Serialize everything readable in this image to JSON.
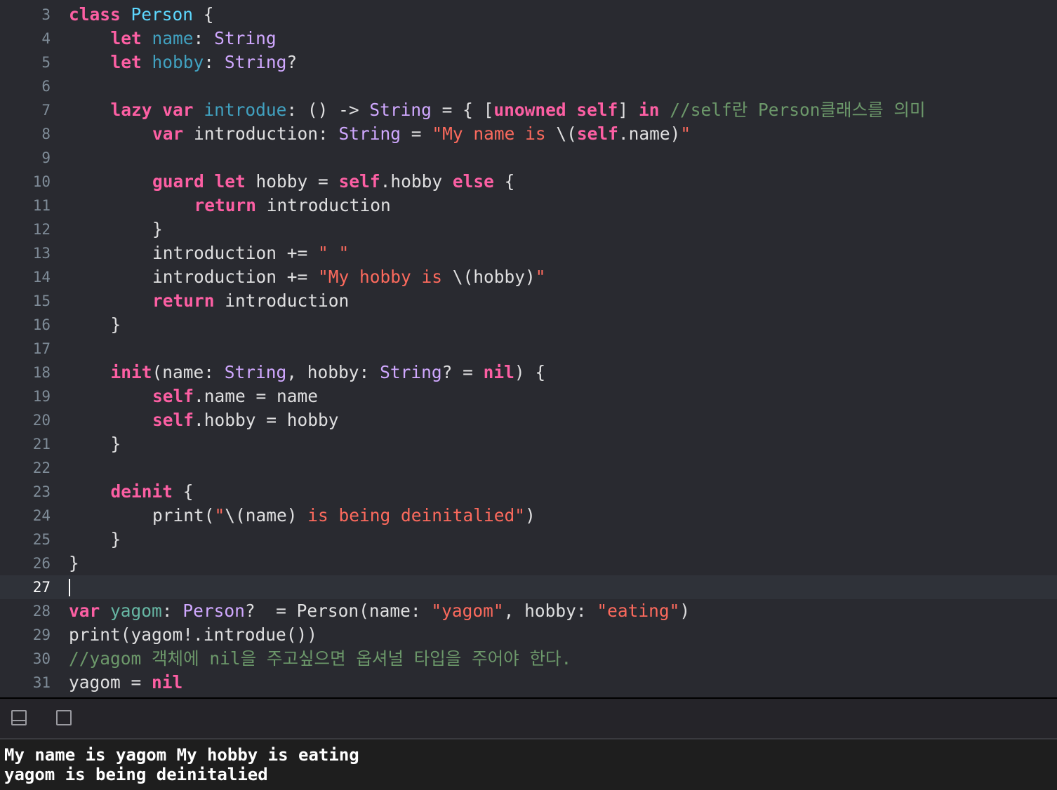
{
  "editor": {
    "current_line": 27,
    "lines": [
      {
        "n": 3,
        "indent": 0,
        "tokens": [
          [
            "kw",
            "class"
          ],
          [
            "p",
            " "
          ],
          [
            "id",
            "Person"
          ],
          [
            "p",
            " {"
          ]
        ]
      },
      {
        "n": 4,
        "indent": 1,
        "tokens": [
          [
            "kw",
            "let"
          ],
          [
            "p",
            " "
          ],
          [
            "sv",
            "name"
          ],
          [
            "p",
            ": "
          ],
          [
            "ty",
            "String"
          ]
        ]
      },
      {
        "n": 5,
        "indent": 1,
        "tokens": [
          [
            "kw",
            "let"
          ],
          [
            "p",
            " "
          ],
          [
            "sv",
            "hobby"
          ],
          [
            "p",
            ": "
          ],
          [
            "ty",
            "String"
          ],
          [
            "p",
            "?"
          ]
        ]
      },
      {
        "n": 6,
        "indent": 0,
        "tokens": []
      },
      {
        "n": 7,
        "indent": 1,
        "tokens": [
          [
            "kw",
            "lazy"
          ],
          [
            "p",
            " "
          ],
          [
            "kw",
            "var"
          ],
          [
            "p",
            " "
          ],
          [
            "sv",
            "introdue"
          ],
          [
            "p",
            ": () -> "
          ],
          [
            "ty",
            "String"
          ],
          [
            "p",
            " = { ["
          ],
          [
            "kw",
            "unowned"
          ],
          [
            "p",
            " "
          ],
          [
            "kw",
            "self"
          ],
          [
            "p",
            "] "
          ],
          [
            "kw",
            "in"
          ],
          [
            "p",
            " "
          ],
          [
            "cm",
            "//self란 Person클래스를 의미"
          ]
        ]
      },
      {
        "n": 8,
        "indent": 2,
        "tokens": [
          [
            "kw",
            "var"
          ],
          [
            "p",
            " introduction: "
          ],
          [
            "ty",
            "String"
          ],
          [
            "p",
            " = "
          ],
          [
            "str",
            "\"My name is "
          ],
          [
            "p",
            "\\("
          ],
          [
            "kw",
            "self"
          ],
          [
            "p",
            ".name)"
          ],
          [
            "str",
            "\""
          ]
        ]
      },
      {
        "n": 9,
        "indent": 0,
        "tokens": []
      },
      {
        "n": 10,
        "indent": 2,
        "tokens": [
          [
            "kw",
            "guard"
          ],
          [
            "p",
            " "
          ],
          [
            "kw",
            "let"
          ],
          [
            "p",
            " hobby = "
          ],
          [
            "kw",
            "self"
          ],
          [
            "p",
            ".hobby "
          ],
          [
            "kw",
            "else"
          ],
          [
            "p",
            " {"
          ]
        ]
      },
      {
        "n": 11,
        "indent": 3,
        "tokens": [
          [
            "kw",
            "return"
          ],
          [
            "p",
            " introduction"
          ]
        ]
      },
      {
        "n": 12,
        "indent": 2,
        "tokens": [
          [
            "p",
            "}"
          ]
        ]
      },
      {
        "n": 13,
        "indent": 2,
        "tokens": [
          [
            "p",
            "introduction += "
          ],
          [
            "str",
            "\" \""
          ]
        ]
      },
      {
        "n": 14,
        "indent": 2,
        "tokens": [
          [
            "p",
            "introduction += "
          ],
          [
            "str",
            "\"My hobby is "
          ],
          [
            "p",
            "\\(hobby)"
          ],
          [
            "str",
            "\""
          ]
        ]
      },
      {
        "n": 15,
        "indent": 2,
        "tokens": [
          [
            "kw",
            "return"
          ],
          [
            "p",
            " introduction"
          ]
        ]
      },
      {
        "n": 16,
        "indent": 1,
        "tokens": [
          [
            "p",
            "}"
          ]
        ]
      },
      {
        "n": 17,
        "indent": 0,
        "tokens": []
      },
      {
        "n": 18,
        "indent": 1,
        "tokens": [
          [
            "kw",
            "init"
          ],
          [
            "p",
            "(name: "
          ],
          [
            "ty",
            "String"
          ],
          [
            "p",
            ", hobby: "
          ],
          [
            "ty",
            "String"
          ],
          [
            "p",
            "? = "
          ],
          [
            "kw",
            "nil"
          ],
          [
            "p",
            ") {"
          ]
        ]
      },
      {
        "n": 19,
        "indent": 2,
        "tokens": [
          [
            "kw",
            "self"
          ],
          [
            "p",
            ".name = name"
          ]
        ]
      },
      {
        "n": 20,
        "indent": 2,
        "tokens": [
          [
            "kw",
            "self"
          ],
          [
            "p",
            ".hobby = hobby"
          ]
        ]
      },
      {
        "n": 21,
        "indent": 1,
        "tokens": [
          [
            "p",
            "}"
          ]
        ]
      },
      {
        "n": 22,
        "indent": 0,
        "tokens": []
      },
      {
        "n": 23,
        "indent": 1,
        "tokens": [
          [
            "kw",
            "deinit"
          ],
          [
            "p",
            " {"
          ]
        ]
      },
      {
        "n": 24,
        "indent": 2,
        "tokens": [
          [
            "p",
            "print("
          ],
          [
            "str",
            "\""
          ],
          [
            "p",
            "\\(name)"
          ],
          [
            "str",
            " is being deinitalied\""
          ],
          [
            "p",
            ")"
          ]
        ]
      },
      {
        "n": 25,
        "indent": 1,
        "tokens": [
          [
            "p",
            "}"
          ]
        ]
      },
      {
        "n": 26,
        "indent": 0,
        "tokens": [
          [
            "p",
            "}"
          ]
        ]
      },
      {
        "n": 27,
        "indent": 0,
        "tokens": []
      },
      {
        "n": 28,
        "indent": 0,
        "tokens": [
          [
            "kw",
            "var"
          ],
          [
            "p",
            " "
          ],
          [
            "id2",
            "yagom"
          ],
          [
            "p",
            ": "
          ],
          [
            "ty",
            "Person"
          ],
          [
            "p",
            "?  = Person(name: "
          ],
          [
            "str",
            "\"yagom\""
          ],
          [
            "p",
            ", hobby: "
          ],
          [
            "str",
            "\"eating\""
          ],
          [
            "p",
            ")"
          ]
        ]
      },
      {
        "n": 29,
        "indent": 0,
        "tokens": [
          [
            "p",
            "print(yagom!.introdue())"
          ]
        ]
      },
      {
        "n": 30,
        "indent": 0,
        "tokens": [
          [
            "cm",
            "//yagom 객체에 nil을 주고싶으면 옵셔널 타입을 주어야 한다."
          ]
        ]
      },
      {
        "n": 31,
        "indent": 0,
        "tokens": [
          [
            "p",
            "yagom = "
          ],
          [
            "kw",
            "nil"
          ]
        ]
      }
    ]
  },
  "console_toolbar": {
    "icons": [
      "hide-debug-area-icon",
      "console-view-icon"
    ]
  },
  "console": {
    "output": [
      "My name is yagom My hobby is eating",
      "yagom is being deinitalied"
    ]
  },
  "colors": {
    "editor_bg": "#292a30",
    "keyword": "#fc5fa3",
    "type": "#d0a8ff",
    "declaration": "#5dd8ff",
    "string": "#fc6a5d",
    "comment": "#6c986a",
    "plain": "#dfdfe0"
  }
}
